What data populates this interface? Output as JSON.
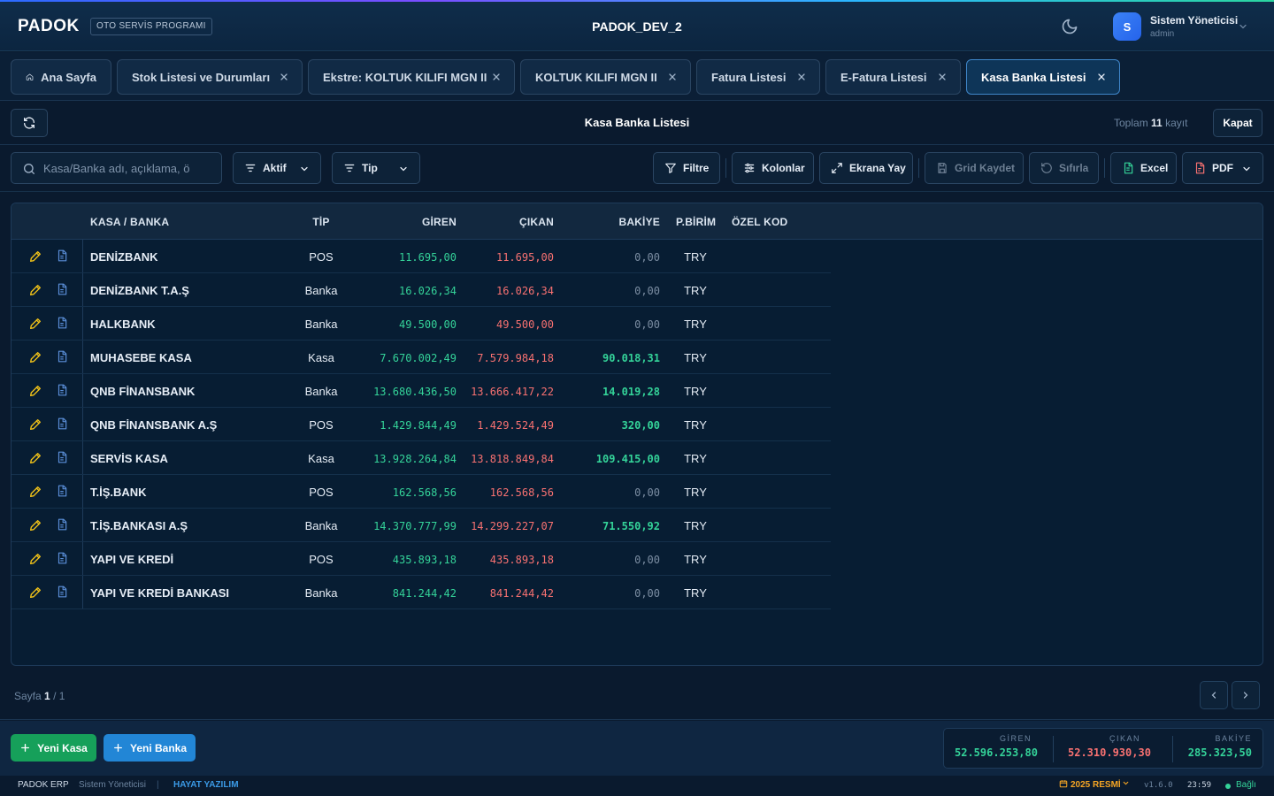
{
  "header": {
    "logo": "PADOK",
    "badge": "OTO SERVİS PROGRAMI",
    "title": "PADOK_DEV_2",
    "user_initial": "S",
    "user_name": "Sistem Yöneticisi",
    "user_role": "admin"
  },
  "tabs": [
    {
      "label": "Ana Sayfa"
    },
    {
      "label": "Stok Listesi ve Durumları"
    },
    {
      "label": "Ekstre: KOLTUK KILIFI MGN II"
    },
    {
      "label": "KOLTUK KILIFI MGN II"
    },
    {
      "label": "Fatura Listesi"
    },
    {
      "label": "E-Fatura Listesi"
    },
    {
      "label": "Kasa Banka Listesi"
    }
  ],
  "titlebar": {
    "title": "Kasa Banka Listesi",
    "total_prefix": "Toplam",
    "total_count": "11",
    "total_suffix": "kayıt",
    "close_label": "Kapat"
  },
  "toolbar": {
    "search_placeholder": "Kasa/Banka adı, açıklama, ö",
    "filter_active": "Aktif",
    "filter_type": "Tip",
    "filtre": "Filtre",
    "kolonlar": "Kolonlar",
    "ekrana_yay": "Ekrana Yay",
    "grid_kaydet": "Grid Kaydet",
    "sifirla": "Sıfırla",
    "excel": "Excel",
    "pdf": "PDF"
  },
  "columns": {
    "name": "KASA / BANKA",
    "tip": "TİP",
    "giren": "GİREN",
    "cikan": "ÇIKAN",
    "bakiye": "BAKİYE",
    "pbirim": "P.BİRİM",
    "ozel_kod": "ÖZEL KOD"
  },
  "rows": [
    {
      "name": "DENİZBANK",
      "tip": "POS",
      "giren": "11.695,00",
      "cikan": "11.695,00",
      "bakiye": "0,00",
      "pbirim": "TRY",
      "zero": true
    },
    {
      "name": "DENİZBANK T.A.Ş",
      "tip": "Banka",
      "giren": "16.026,34",
      "cikan": "16.026,34",
      "bakiye": "0,00",
      "pbirim": "TRY",
      "zero": true
    },
    {
      "name": "HALKBANK",
      "tip": "Banka",
      "giren": "49.500,00",
      "cikan": "49.500,00",
      "bakiye": "0,00",
      "pbirim": "TRY",
      "zero": true
    },
    {
      "name": "MUHASEBE KASA",
      "tip": "Kasa",
      "giren": "7.670.002,49",
      "cikan": "7.579.984,18",
      "bakiye": "90.018,31",
      "pbirim": "TRY",
      "zero": false
    },
    {
      "name": "QNB FİNANSBANK",
      "tip": "Banka",
      "giren": "13.680.436,50",
      "cikan": "13.666.417,22",
      "bakiye": "14.019,28",
      "pbirim": "TRY",
      "zero": false
    },
    {
      "name": "QNB FİNANSBANK A.Ş",
      "tip": "POS",
      "giren": "1.429.844,49",
      "cikan": "1.429.524,49",
      "bakiye": "320,00",
      "pbirim": "TRY",
      "zero": false
    },
    {
      "name": "SERVİS KASA",
      "tip": "Kasa",
      "giren": "13.928.264,84",
      "cikan": "13.818.849,84",
      "bakiye": "109.415,00",
      "pbirim": "TRY",
      "zero": false
    },
    {
      "name": "T.İŞ.BANK",
      "tip": "POS",
      "giren": "162.568,56",
      "cikan": "162.568,56",
      "bakiye": "0,00",
      "pbirim": "TRY",
      "zero": true
    },
    {
      "name": "T.İŞ.BANKASI A.Ş",
      "tip": "Banka",
      "giren": "14.370.777,99",
      "cikan": "14.299.227,07",
      "bakiye": "71.550,92",
      "pbirim": "TRY",
      "zero": false
    },
    {
      "name": "YAPI VE KREDİ",
      "tip": "POS",
      "giren": "435.893,18",
      "cikan": "435.893,18",
      "bakiye": "0,00",
      "pbirim": "TRY",
      "zero": true
    },
    {
      "name": "YAPI VE KREDİ BANKASI",
      "tip": "Banka",
      "giren": "841.244,42",
      "cikan": "841.244,42",
      "bakiye": "0,00",
      "pbirim": "TRY",
      "zero": true
    }
  ],
  "pager": {
    "label": "Sayfa",
    "current": "1",
    "total": "/ 1"
  },
  "actions": {
    "new_kasa": "Yeni Kasa",
    "new_banka": "Yeni Banka"
  },
  "summary": {
    "giren_label": "GİREN",
    "giren_value": "52.596.253,80",
    "cikan_label": "ÇIKAN",
    "cikan_value": "52.310.930,30",
    "bakiye_label": "BAKİYE",
    "bakiye_value": "285.323,50"
  },
  "statusbar": {
    "app": "PADOK ERP",
    "user": "Sistem Yöneticisi",
    "divider": "|",
    "company": "HAYAT YAZILIM",
    "period": "2025 RESMİ",
    "version": "v1.6.0",
    "time": "23:59",
    "connection": "Bağlı"
  },
  "colors": {
    "accent": "#3f86c9",
    "positive": "#34d399",
    "negative": "#f87171",
    "edit_icon": "#f5c518"
  }
}
